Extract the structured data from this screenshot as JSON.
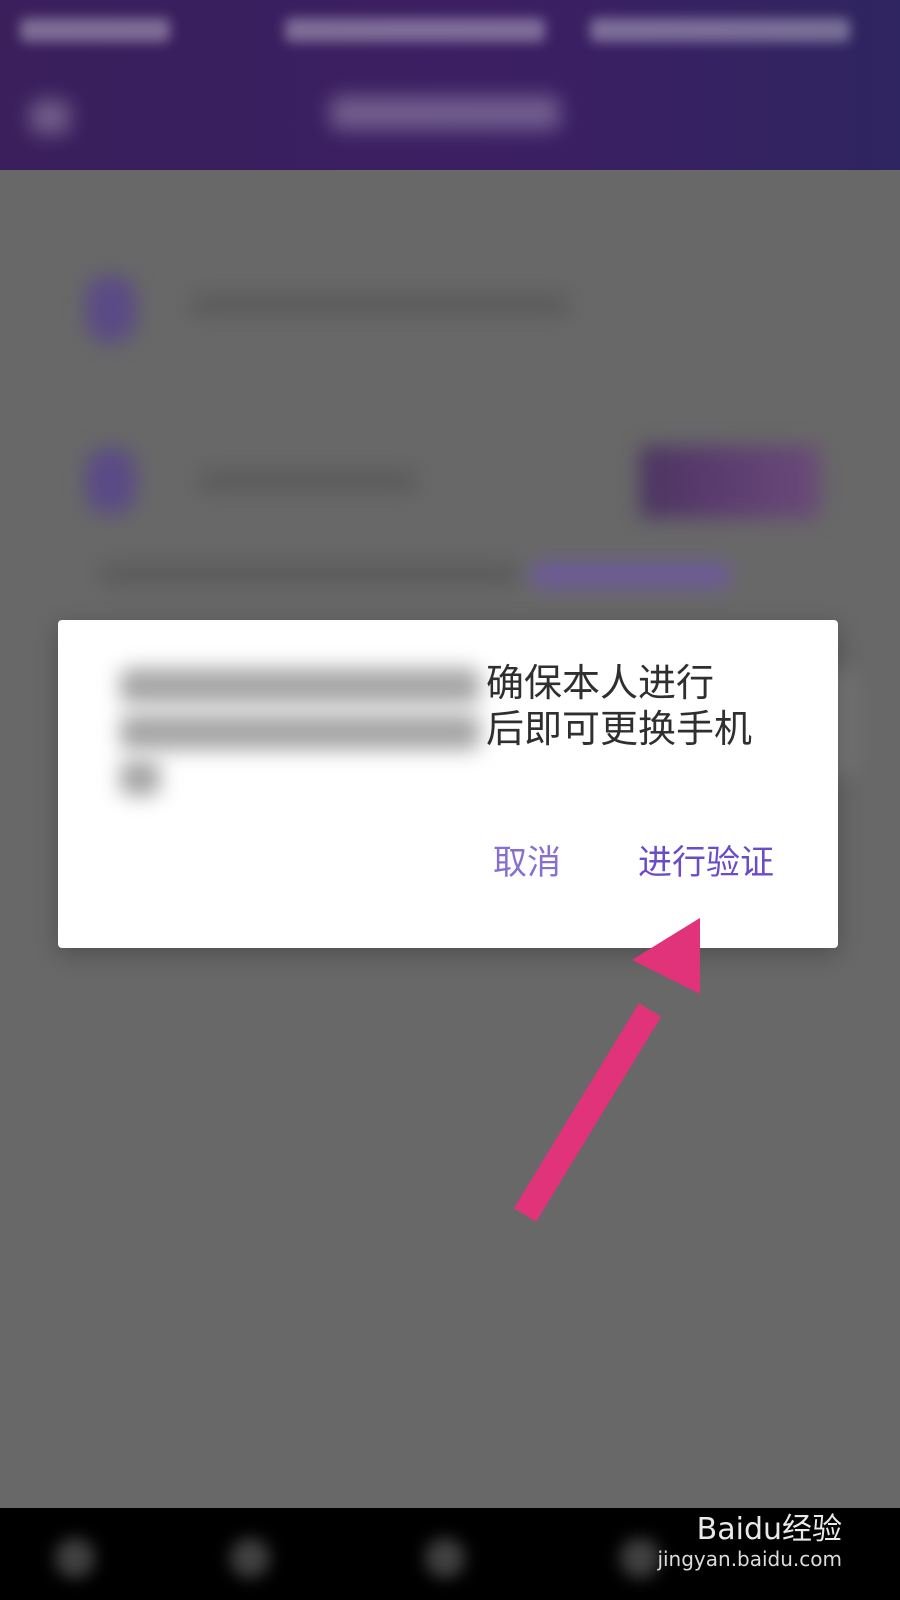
{
  "dialog": {
    "message_visible": "确保本人进行\n后即可更换手机",
    "cancel_label": "取消",
    "verify_label": "进行验证"
  },
  "watermark": {
    "text": "Baidu经验",
    "subtext": "jingyan.baidu.com"
  },
  "colors": {
    "header_purple": "#3b1f63",
    "dialog_button": "#6a4cc8",
    "arrow_pink": "#e0337a",
    "overlay_gray": "#686868"
  }
}
